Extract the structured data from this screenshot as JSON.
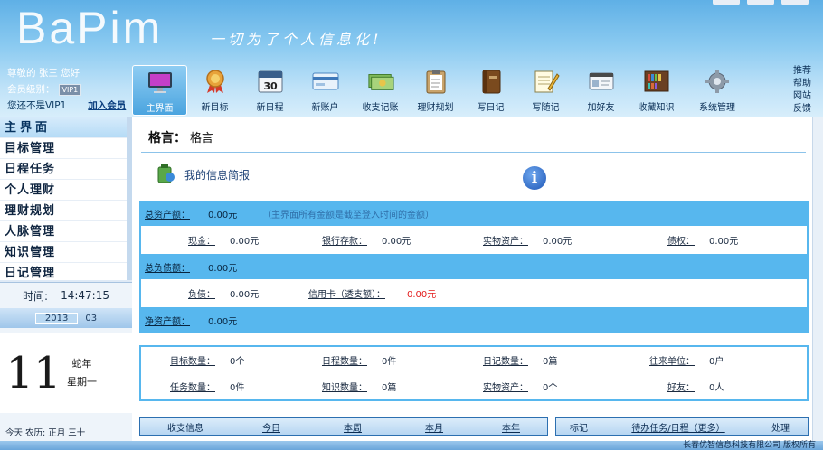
{
  "app": {
    "logo": "BaPim",
    "slogan": "一切为了个人信息化!"
  },
  "user": {
    "greeting": "尊敬的 张三 您好",
    "level_label": "会员级别：",
    "level_badge": "VIP1",
    "not_vip_text": "您还不是VIP1",
    "join_link": "加入会员"
  },
  "toolbar": [
    {
      "label": "主界面",
      "icon": "monitor-icon"
    },
    {
      "label": "新目标",
      "icon": "medal-icon"
    },
    {
      "label": "新日程",
      "icon": "calendar-30-icon"
    },
    {
      "label": "新账户",
      "icon": "bank-card-icon"
    },
    {
      "label": "收支记账",
      "icon": "money-icon"
    },
    {
      "label": "理财规划",
      "icon": "clipboard-icon"
    },
    {
      "label": "写日记",
      "icon": "book-icon"
    },
    {
      "label": "写随记",
      "icon": "notepad-pencil-icon"
    },
    {
      "label": "加好友",
      "icon": "contact-card-icon"
    },
    {
      "label": "收藏知识",
      "icon": "bookshelf-icon"
    },
    {
      "label": "系统管理",
      "icon": "gear-icon"
    }
  ],
  "side_links": [
    "推荐",
    "帮助",
    "网站",
    "反馈"
  ],
  "nav": [
    "主界面",
    "目标管理",
    "日程任务",
    "个人理财",
    "理财规划",
    "人脉管理",
    "知识管理",
    "日记管理"
  ],
  "clock": {
    "time_label": "时间:",
    "time_value": "14:47:15",
    "year": "2013",
    "month": "03",
    "day": "11",
    "zodiac": "蛇年",
    "weekday": "星期一",
    "lunar": "今天   农历: 正月 三十"
  },
  "main": {
    "motto_label": "格言：",
    "motto_value": "格言",
    "info_title": "我的信息简报",
    "info_button": "i",
    "total_assets": {
      "label": "总资产额：",
      "value": "0.00元",
      "note": "（主界面所有金额是截至登入时间的金额）"
    },
    "assets_row": [
      {
        "label": "现金：",
        "value": "0.00元"
      },
      {
        "label": "银行存款：",
        "value": "0.00元"
      },
      {
        "label": "实物资产：",
        "value": "0.00元"
      },
      {
        "label": "债权：",
        "value": "0.00元"
      }
    ],
    "total_liab": {
      "label": "总负债额：",
      "value": "0.00元"
    },
    "liab_row": [
      {
        "label": "负债：",
        "value": "0.00元"
      },
      {
        "label": "信用卡（透支额）：",
        "value": "0.00元"
      }
    ],
    "net_assets": {
      "label": "净资产额：",
      "value": "0.00元"
    },
    "stats_row1": [
      {
        "label": "目标数量：",
        "value": "0个"
      },
      {
        "label": "日程数量：",
        "value": "0件"
      },
      {
        "label": "日记数量：",
        "value": "0篇"
      },
      {
        "label": "往来单位：",
        "value": "0户"
      }
    ],
    "stats_row2": [
      {
        "label": "任务数量：",
        "value": "0件"
      },
      {
        "label": "知识数量：",
        "value": "0篇"
      },
      {
        "label": "实物资产：",
        "value": "0个"
      },
      {
        "label": "好友：",
        "value": "0人"
      }
    ],
    "income_bar": [
      "收支信息",
      "今日",
      "本周",
      "本月",
      "本年"
    ],
    "tasks_bar": [
      "标记",
      "待办任务/日程（更多）",
      "处理"
    ]
  },
  "footer": "长春优智信息科技有限公司 版权所有",
  "colors": {
    "band": "#57b7ee",
    "header": "#8ccbf1",
    "accent_red": "#e31b1b"
  }
}
